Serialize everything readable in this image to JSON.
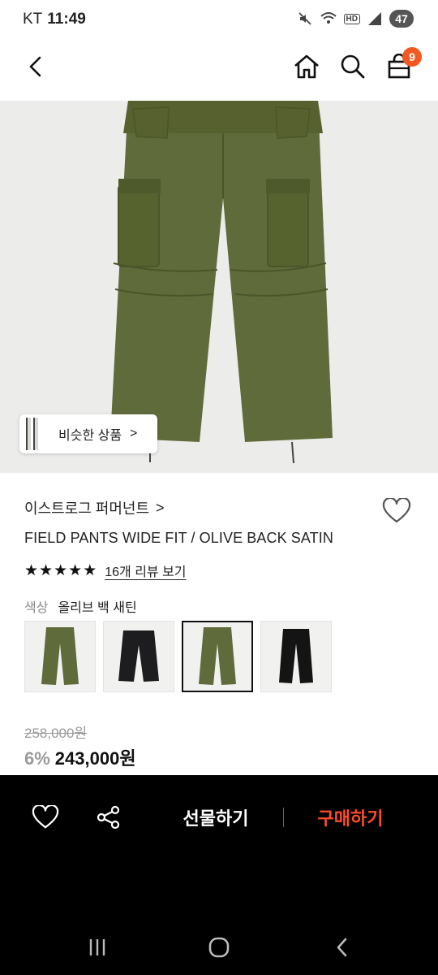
{
  "status_bar": {
    "carrier": "KT",
    "time": "11:49",
    "battery": "47",
    "hd": "HD"
  },
  "nav": {
    "cart_count": "9"
  },
  "hero": {
    "similar_label": "비슷한 상품",
    "similar_chevron": ">"
  },
  "product": {
    "brand": "이스트로그 퍼머넌트",
    "brand_chevron": ">",
    "name": "FIELD PANTS WIDE FIT / OLIVE BACK SATIN",
    "rating_stars": 5,
    "review_link": "16개 리뷰 보기",
    "color_label": "색상",
    "color_value": "올리브 백 새틴",
    "swatches": [
      {
        "color": "olive",
        "hex": "#5f6b3a",
        "selected": false
      },
      {
        "color": "black",
        "hex": "#1d1d1f",
        "selected": false
      },
      {
        "color": "olive",
        "hex": "#5f6b3a",
        "selected": true
      },
      {
        "color": "black",
        "hex": "#141414",
        "selected": false
      }
    ],
    "original_price": "258,000원",
    "discount": "6%",
    "price": "243,000원"
  },
  "action_bar": {
    "gift_label": "선물하기",
    "buy_label": "구매하기"
  },
  "colors": {
    "accent": "#f05a22",
    "buy": "#ff4b2b",
    "olive": "#5f6b3a"
  }
}
